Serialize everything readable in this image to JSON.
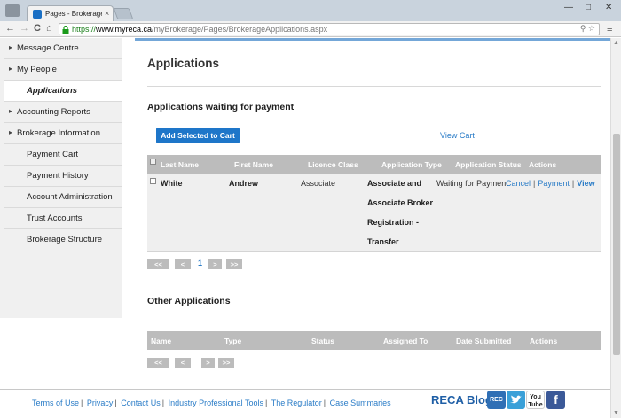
{
  "browser": {
    "tab_title": "Pages - Brokerage Applic",
    "tab_close": "×",
    "url_scheme": "https://",
    "url_host": "www.myreca.ca",
    "url_path": "/myBrokerage/Pages/BrokerageApplications.aspx",
    "back": "←",
    "forward": "→",
    "reload": "C",
    "home": "⌂",
    "menu": "≡",
    "minimize": "—",
    "maximize": "□",
    "close": "✕"
  },
  "sidebar": {
    "items": [
      {
        "label": "Message Centre",
        "arrow": "▸"
      },
      {
        "label": "My People",
        "arrow": "▸"
      },
      {
        "label": "Applications",
        "arrow": ""
      },
      {
        "label": "Accounting Reports",
        "arrow": "▸"
      },
      {
        "label": "Brokerage Information",
        "arrow": "▸"
      },
      {
        "label": "Payment Cart",
        "arrow": ""
      },
      {
        "label": "Payment History",
        "arrow": ""
      },
      {
        "label": "Account Administration",
        "arrow": ""
      },
      {
        "label": "Trust Accounts",
        "arrow": ""
      },
      {
        "label": "Brokerage Structure",
        "arrow": ""
      }
    ]
  },
  "main": {
    "title": "Applications",
    "waiting": {
      "title": "Applications waiting for payment",
      "add_button": "Add Selected to Cart",
      "view_cart": "View Cart",
      "columns": [
        "Last Name",
        "First Name",
        "Licence Class",
        "Application Type",
        "Application Status",
        "Actions"
      ],
      "rows": [
        {
          "last_name": "White",
          "first_name": "Andrew",
          "licence_class": "Associate",
          "application_type": "Associate and Associate Broker Registration - Transfer",
          "status": "Waiting for Payment",
          "actions": {
            "cancel": "Cancel",
            "payment": "Payment",
            "view": "View",
            "separator": "|"
          }
        }
      ],
      "pager": {
        "first": "<<",
        "prev": "<",
        "page": "1",
        "next": ">",
        "last": ">>"
      }
    },
    "other": {
      "title": "Other Applications",
      "columns": [
        "Name",
        "Type",
        "Status",
        "Assigned To",
        "Date Submitted",
        "Actions"
      ],
      "pager": {
        "first": "<<",
        "prev": "<",
        "next": ">",
        "last": ">>"
      }
    }
  },
  "footer": {
    "links": [
      "Terms of Use",
      "Privacy",
      "Contact Us",
      "Industry Professional Tools",
      "The Regulator",
      "Case Summaries"
    ],
    "separator": "|",
    "blog": "RECA Blog",
    "social": {
      "rss": "REC",
      "youtube": "You Tube",
      "twitter_icon": "twitter-icon",
      "facebook": "f"
    }
  }
}
